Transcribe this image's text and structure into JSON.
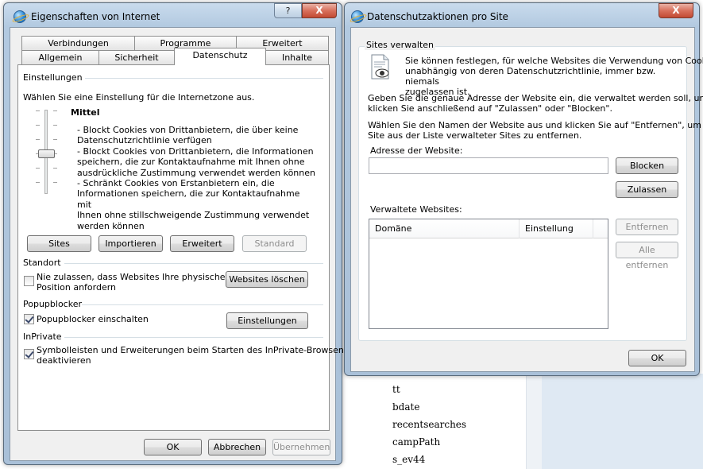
{
  "background": {
    "list_items": [
      "tt",
      "bdate",
      "recentsearches",
      "campPath",
      "s_ev44"
    ]
  },
  "left_window": {
    "title": "Eigenschaften von Internet",
    "help_label": "?",
    "close_label": "X",
    "tabs_row1": [
      "Verbindungen",
      "Programme",
      "Erweitert"
    ],
    "tabs_row2": [
      "Allgemein",
      "Sicherheit",
      "Datenschutz",
      "Inhalte"
    ],
    "settings_group": "Einstellungen",
    "zone_instruction": "Wählen Sie eine Einstellung für die Internetzone aus.",
    "level_name": "Mittel",
    "level_description": [
      "- Blockt Cookies von Drittanbietern, die über keine",
      "Datenschutzrichtlinie verfügen",
      "- Blockt Cookies von Drittanbietern, die Informationen",
      "speichern, die zur Kontaktaufnahme mit Ihnen ohne",
      "ausdrückliche Zustimmung verwendet werden können",
      "- Schränkt Cookies von Erstanbietern ein, die",
      "Informationen speichern, die zur Kontaktaufnahme mit",
      "Ihnen ohne stillschweigende Zustimmung verwendet",
      "werden können"
    ],
    "buttons": {
      "sites": "Sites",
      "import": "Importieren",
      "advanced": "Erweitert",
      "default": "Standard"
    },
    "location_group": "Standort",
    "location_checkbox": [
      "Nie zulassen, dass Websites Ihre physische",
      "Position anfordern"
    ],
    "location_checked": false,
    "clear_sites": "Websites löschen",
    "popup_group": "Popupblocker",
    "popup_checkbox": "Popupblocker einschalten",
    "popup_checked": true,
    "popup_settings": "Einstellungen",
    "inprivate_group": "InPrivate",
    "inprivate_checkbox": [
      "Symbolleisten und Erweiterungen beim Starten des InPrivate-Browsens",
      "deaktivieren"
    ],
    "inprivate_checked": true,
    "footer": {
      "ok": "OK",
      "cancel": "Abbrechen",
      "apply": "Übernehmen"
    }
  },
  "right_window": {
    "title": "Datenschutzaktionen pro Site",
    "close_label": "X",
    "group_title": "Sites verwalten",
    "intro": [
      "Sie können festlegen, für welche Websites die Verwendung von Cookies,",
      "unabhängig von deren Datenschutzrichtlinie, immer bzw. niemals",
      "zugelassen ist."
    ],
    "instruction1": [
      "Geben Sie die genaue Adresse der Website ein, die verwaltet werden soll, und",
      "klicken Sie anschließend auf \"Zulassen\" oder \"Blocken\"."
    ],
    "instruction2": [
      "Wählen Sie den Namen der Website aus und klicken Sie auf \"Entfernen\", um die",
      "Site aus der Liste verwalteter Sites zu entfernen."
    ],
    "address_label": "Adresse der Website:",
    "address_value": "",
    "block": "Blocken",
    "allow": "Zulassen",
    "managed_label": "Verwaltete Websites:",
    "columns": [
      "Domäne",
      "Einstellung"
    ],
    "remove": "Entfernen",
    "remove_all": "Alle entfernen",
    "ok": "OK"
  }
}
